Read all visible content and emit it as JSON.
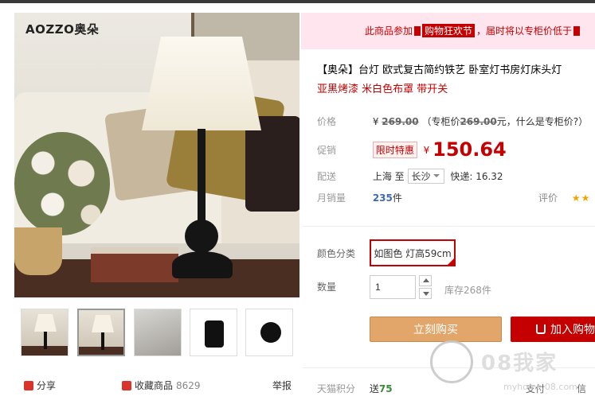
{
  "brand": {
    "logo_text": "AOZZO奥朵"
  },
  "gallery": {
    "bottom_actions": {
      "share_label": "分享",
      "favorite_label": "收藏商品",
      "favorite_count": "8629",
      "report_label": "举报"
    }
  },
  "promo": {
    "prefix": "此商品参加",
    "tag": "购物狂欢节",
    "suffix": "，届时将以专柜价低于"
  },
  "product": {
    "title": "【奥朵】台灯 欧式复古简约铁艺 卧室灯书房灯床头灯",
    "subtitle": "亚黑烤漆 米白色布罩 带开关"
  },
  "price": {
    "label": "价格",
    "currency": "¥",
    "original": "269.00",
    "counter_note_prefix": "（专柜价",
    "counter_value": "269.00",
    "counter_note_suffix": "元，",
    "counter_link": "什么是专柜价?",
    "counter_close": "）"
  },
  "promotion": {
    "label": "促销",
    "badge": "限时特惠",
    "currency": "¥",
    "price": "150.64"
  },
  "delivery": {
    "label": "配送",
    "from": "上海",
    "to_word": "至",
    "to_city": "长沙",
    "shipping": "快递: 16.32"
  },
  "sales": {
    "label": "月销量",
    "count": "235",
    "unit": "件",
    "rating_label": "评价",
    "rating_stars": "★★"
  },
  "options": {
    "color_label": "颜色分类",
    "color_selected": "如图色 灯高59cm"
  },
  "quantity": {
    "label": "数量",
    "value": "1",
    "stock": "库存268件"
  },
  "buttons": {
    "buy_now": "立刻购买",
    "add_cart": "加入购物"
  },
  "footer": {
    "points_label": "天猫积分",
    "points_value_prefix": "送",
    "points_value": "75",
    "pay_label": "支付",
    "credit_label": "信"
  },
  "watermark": {
    "text": "08我家",
    "url": "myhome.08.com"
  },
  "colors": {
    "accent": "#c40000",
    "buy_button": "#e2a66a",
    "promo_bg": "#ffe5ee"
  }
}
